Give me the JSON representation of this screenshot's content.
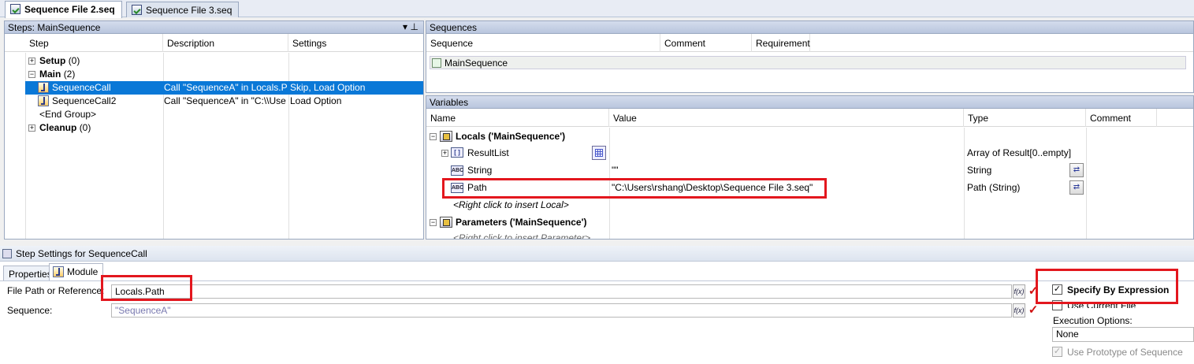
{
  "doc_tabs": [
    {
      "label": "Sequence File 2.seq",
      "active": true
    },
    {
      "label": "Sequence File 3.seq",
      "active": false
    }
  ],
  "steps_pane": {
    "title": "Steps: MainSequence",
    "dropdown_glyph": "▾",
    "pin_glyph": "⊥",
    "columns": [
      "Step",
      "Description",
      "Settings"
    ],
    "groups": {
      "setup": {
        "name": "Setup",
        "count": "(0)"
      },
      "main": {
        "name": "Main",
        "count": "(2)"
      },
      "cleanup": {
        "name": "Cleanup",
        "count": "(0)"
      }
    },
    "rows": [
      {
        "step": "SequenceCall",
        "description": "Call \"SequenceA\" in Locals.P...",
        "settings": "Skip, Load Option"
      },
      {
        "step": "SequenceCall2",
        "description": "Call \"SequenceA\" in \"C:\\\\Use...",
        "settings": "Load Option"
      }
    ],
    "end_group": "<End Group>"
  },
  "sequences_pane": {
    "title": "Sequences",
    "columns": [
      "Sequence",
      "Comment",
      "Requirement"
    ],
    "items": [
      "MainSequence"
    ]
  },
  "variables_pane": {
    "title": "Variables",
    "columns": [
      "Name",
      "Value",
      "Type",
      "Comment"
    ],
    "locals_label": "Locals ('MainSequence')",
    "locals": [
      {
        "name": "ResultList",
        "value": "",
        "type": "Array of Result[0..empty]"
      },
      {
        "name": "String",
        "value": "\"\"",
        "type": "String"
      },
      {
        "name": "Path",
        "value": "\"C:\\Users\\rshang\\Desktop\\Sequence File 3.seq\"",
        "type": "Path (String)"
      }
    ],
    "insert_local": "<Right click to insert Local>",
    "parameters_label": "Parameters ('MainSequence')",
    "insert_parameter": "<Right click to insert Parameter>"
  },
  "step_settings": {
    "title": "Step Settings for SequenceCall",
    "tabs": [
      {
        "label": "Properties",
        "active": false
      },
      {
        "label": "Module",
        "active": true
      }
    ],
    "file_path_label": "File Path or Reference:",
    "file_path_value": "Locals.Path",
    "sequence_label": "Sequence:",
    "sequence_value": "\"SequenceA\"",
    "fx_label": "f(x)",
    "check_glyph": "✓",
    "specify_by_expression": {
      "label": "Specify By Expression",
      "checked": true
    },
    "use_current_file": {
      "label": "Use Current File",
      "checked": false
    },
    "execution_options_label": "Execution Options:",
    "execution_options_value": "None",
    "use_prototype": {
      "label": "Use Prototype of Sequence",
      "checked": true,
      "disabled": true
    }
  },
  "colors": {
    "selection": "#0a78d7",
    "highlight_box": "#e3171e",
    "pane_header": "#c6d1e6"
  }
}
